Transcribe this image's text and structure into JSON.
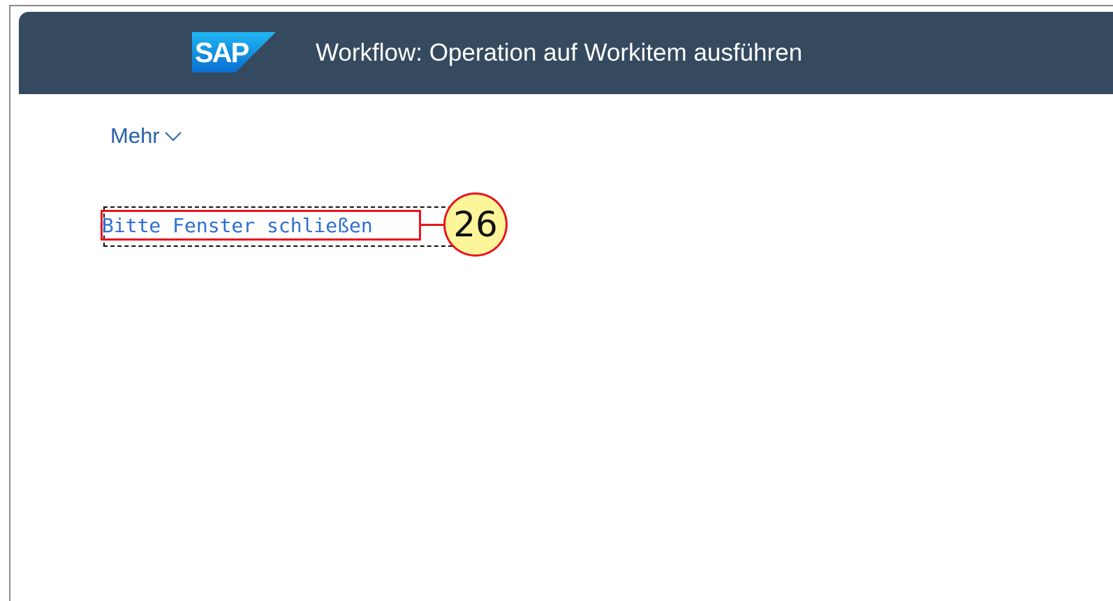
{
  "header": {
    "logo_text": "SAP",
    "title": "Workflow: Operation auf Workitem ausführen",
    "background_color": "#354a5f"
  },
  "toolbar": {
    "more_label": "Mehr",
    "more_icon": "chevron-down-icon"
  },
  "content": {
    "message": "Bitte Fenster schließen",
    "link_color": "#2e6fd6"
  },
  "annotation": {
    "step_number": "26",
    "highlight_color": "#e8141d",
    "badge_color": "#fcf59a"
  }
}
